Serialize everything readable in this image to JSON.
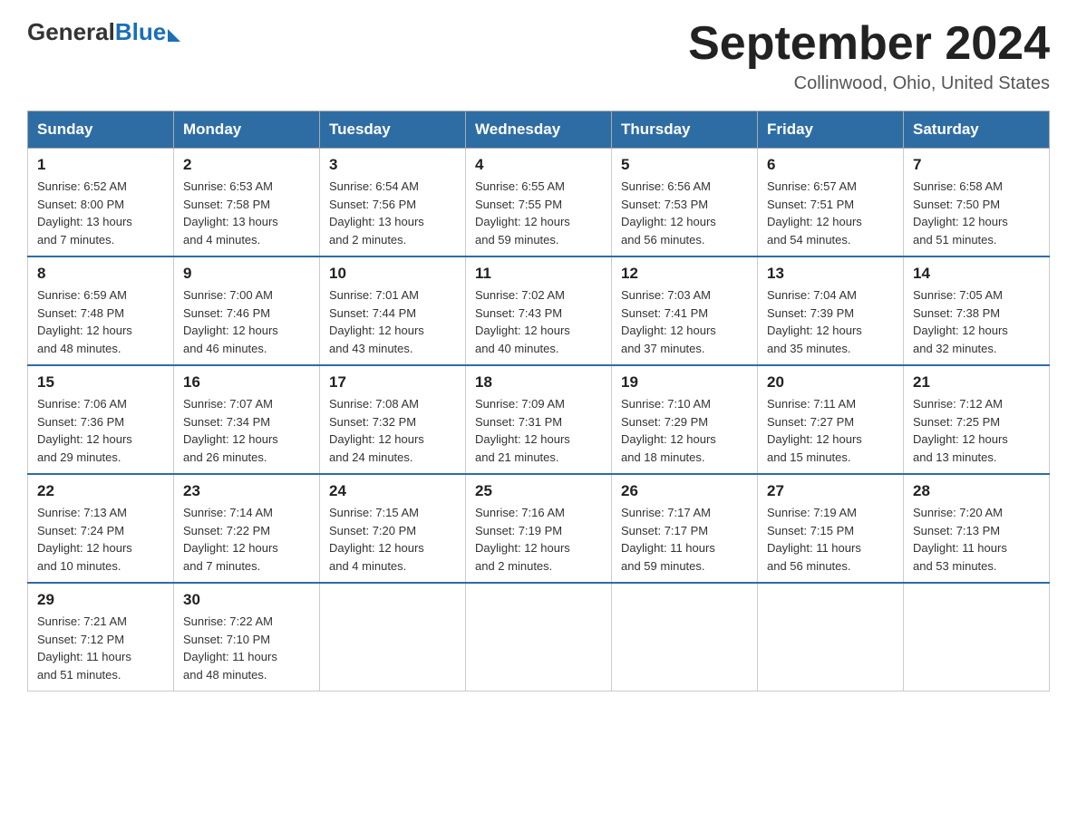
{
  "header": {
    "logo_general": "General",
    "logo_blue": "Blue",
    "title": "September 2024",
    "subtitle": "Collinwood, Ohio, United States"
  },
  "days_of_week": [
    "Sunday",
    "Monday",
    "Tuesday",
    "Wednesday",
    "Thursday",
    "Friday",
    "Saturday"
  ],
  "weeks": [
    [
      {
        "day": "1",
        "sunrise": "6:52 AM",
        "sunset": "8:00 PM",
        "daylight": "13 hours and 7 minutes."
      },
      {
        "day": "2",
        "sunrise": "6:53 AM",
        "sunset": "7:58 PM",
        "daylight": "13 hours and 4 minutes."
      },
      {
        "day": "3",
        "sunrise": "6:54 AM",
        "sunset": "7:56 PM",
        "daylight": "13 hours and 2 minutes."
      },
      {
        "day": "4",
        "sunrise": "6:55 AM",
        "sunset": "7:55 PM",
        "daylight": "12 hours and 59 minutes."
      },
      {
        "day": "5",
        "sunrise": "6:56 AM",
        "sunset": "7:53 PM",
        "daylight": "12 hours and 56 minutes."
      },
      {
        "day": "6",
        "sunrise": "6:57 AM",
        "sunset": "7:51 PM",
        "daylight": "12 hours and 54 minutes."
      },
      {
        "day": "7",
        "sunrise": "6:58 AM",
        "sunset": "7:50 PM",
        "daylight": "12 hours and 51 minutes."
      }
    ],
    [
      {
        "day": "8",
        "sunrise": "6:59 AM",
        "sunset": "7:48 PM",
        "daylight": "12 hours and 48 minutes."
      },
      {
        "day": "9",
        "sunrise": "7:00 AM",
        "sunset": "7:46 PM",
        "daylight": "12 hours and 46 minutes."
      },
      {
        "day": "10",
        "sunrise": "7:01 AM",
        "sunset": "7:44 PM",
        "daylight": "12 hours and 43 minutes."
      },
      {
        "day": "11",
        "sunrise": "7:02 AM",
        "sunset": "7:43 PM",
        "daylight": "12 hours and 40 minutes."
      },
      {
        "day": "12",
        "sunrise": "7:03 AM",
        "sunset": "7:41 PM",
        "daylight": "12 hours and 37 minutes."
      },
      {
        "day": "13",
        "sunrise": "7:04 AM",
        "sunset": "7:39 PM",
        "daylight": "12 hours and 35 minutes."
      },
      {
        "day": "14",
        "sunrise": "7:05 AM",
        "sunset": "7:38 PM",
        "daylight": "12 hours and 32 minutes."
      }
    ],
    [
      {
        "day": "15",
        "sunrise": "7:06 AM",
        "sunset": "7:36 PM",
        "daylight": "12 hours and 29 minutes."
      },
      {
        "day": "16",
        "sunrise": "7:07 AM",
        "sunset": "7:34 PM",
        "daylight": "12 hours and 26 minutes."
      },
      {
        "day": "17",
        "sunrise": "7:08 AM",
        "sunset": "7:32 PM",
        "daylight": "12 hours and 24 minutes."
      },
      {
        "day": "18",
        "sunrise": "7:09 AM",
        "sunset": "7:31 PM",
        "daylight": "12 hours and 21 minutes."
      },
      {
        "day": "19",
        "sunrise": "7:10 AM",
        "sunset": "7:29 PM",
        "daylight": "12 hours and 18 minutes."
      },
      {
        "day": "20",
        "sunrise": "7:11 AM",
        "sunset": "7:27 PM",
        "daylight": "12 hours and 15 minutes."
      },
      {
        "day": "21",
        "sunrise": "7:12 AM",
        "sunset": "7:25 PM",
        "daylight": "12 hours and 13 minutes."
      }
    ],
    [
      {
        "day": "22",
        "sunrise": "7:13 AM",
        "sunset": "7:24 PM",
        "daylight": "12 hours and 10 minutes."
      },
      {
        "day": "23",
        "sunrise": "7:14 AM",
        "sunset": "7:22 PM",
        "daylight": "12 hours and 7 minutes."
      },
      {
        "day": "24",
        "sunrise": "7:15 AM",
        "sunset": "7:20 PM",
        "daylight": "12 hours and 4 minutes."
      },
      {
        "day": "25",
        "sunrise": "7:16 AM",
        "sunset": "7:19 PM",
        "daylight": "12 hours and 2 minutes."
      },
      {
        "day": "26",
        "sunrise": "7:17 AM",
        "sunset": "7:17 PM",
        "daylight": "11 hours and 59 minutes."
      },
      {
        "day": "27",
        "sunrise": "7:19 AM",
        "sunset": "7:15 PM",
        "daylight": "11 hours and 56 minutes."
      },
      {
        "day": "28",
        "sunrise": "7:20 AM",
        "sunset": "7:13 PM",
        "daylight": "11 hours and 53 minutes."
      }
    ],
    [
      {
        "day": "29",
        "sunrise": "7:21 AM",
        "sunset": "7:12 PM",
        "daylight": "11 hours and 51 minutes."
      },
      {
        "day": "30",
        "sunrise": "7:22 AM",
        "sunset": "7:10 PM",
        "daylight": "11 hours and 48 minutes."
      },
      null,
      null,
      null,
      null,
      null
    ]
  ],
  "labels": {
    "sunrise": "Sunrise:",
    "sunset": "Sunset:",
    "daylight": "Daylight:"
  }
}
